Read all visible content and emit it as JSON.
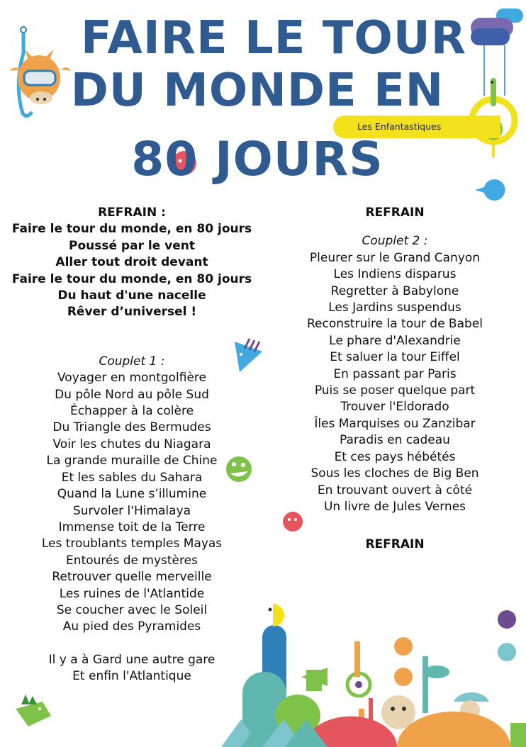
{
  "title": {
    "line1": "FAIRE LE TOUR",
    "line2": "DU MONDE EN",
    "line3_prefix": "8",
    "line3_zero": "0",
    "line3_suffix": " JOURS"
  },
  "artist_badge": "Les Enfantastiques",
  "left": {
    "refrain_heading": "REFRAIN :",
    "refrain_lines": [
      "Faire le tour du monde, en 80 jours",
      "Poussé par le vent",
      "Aller tout droit devant",
      "Faire le tour du monde, en 80 jours",
      "Du haut d'une nacelle",
      "Rêver d’universel !"
    ],
    "couplet1_heading": "Couplet 1 :",
    "couplet1_lines": [
      "Voyager en montgolfière",
      "Du pôle Nord au pôle Sud",
      "Échapper à la colère",
      "Du Triangle des Bermudes",
      "Voir les chutes du Niagara",
      "La grande muraille de Chine",
      "Et les sables du Sahara",
      "Quand la Lune s’illumine",
      "Survoler l'Himalaya",
      "Immense toit de la Terre",
      "Les troublants temples Mayas",
      "Entourés de mystères",
      "Retrouver quelle merveille",
      "Les ruines de l'Atlantide",
      "Se coucher avec le Soleil",
      "Au pied des Pyramides"
    ],
    "closing_lines": [
      "Il y a à Gard une autre gare",
      "Et enfin l'Atlantique"
    ]
  },
  "right": {
    "refrain_top": "REFRAIN",
    "couplet2_heading": "Couplet 2 :",
    "couplet2_lines": [
      "Pleurer sur le Grand Canyon",
      "Les Indiens disparus",
      "Regretter à Babylone",
      "Les Jardins suspendus",
      "Reconstruire la tour de Babel",
      "Le phare d'Alexandrie",
      "Et saluer la tour Eiffel",
      "En passant par Paris",
      "Puis se poser quelque part",
      "Trouver l'Eldorado",
      "Îles Marquises ou Zanzibar",
      "Paradis en cadeau",
      "Et ces pays hébétés",
      "Sous les cloches de Big Ben",
      "En trouvant ouvert à côté",
      "Un livre de Jules Vernes"
    ],
    "refrain_bottom": "REFRAIN"
  },
  "colors": {
    "title": "#2f5b91",
    "badge": "#f3e11b",
    "teal": "#5fb7b0",
    "green": "#7ec24a",
    "orange": "#f0a24a",
    "pink": "#e4555e",
    "blue": "#2f7fb8",
    "purple": "#6e4a8e",
    "light_blue": "#3fa9e0"
  }
}
